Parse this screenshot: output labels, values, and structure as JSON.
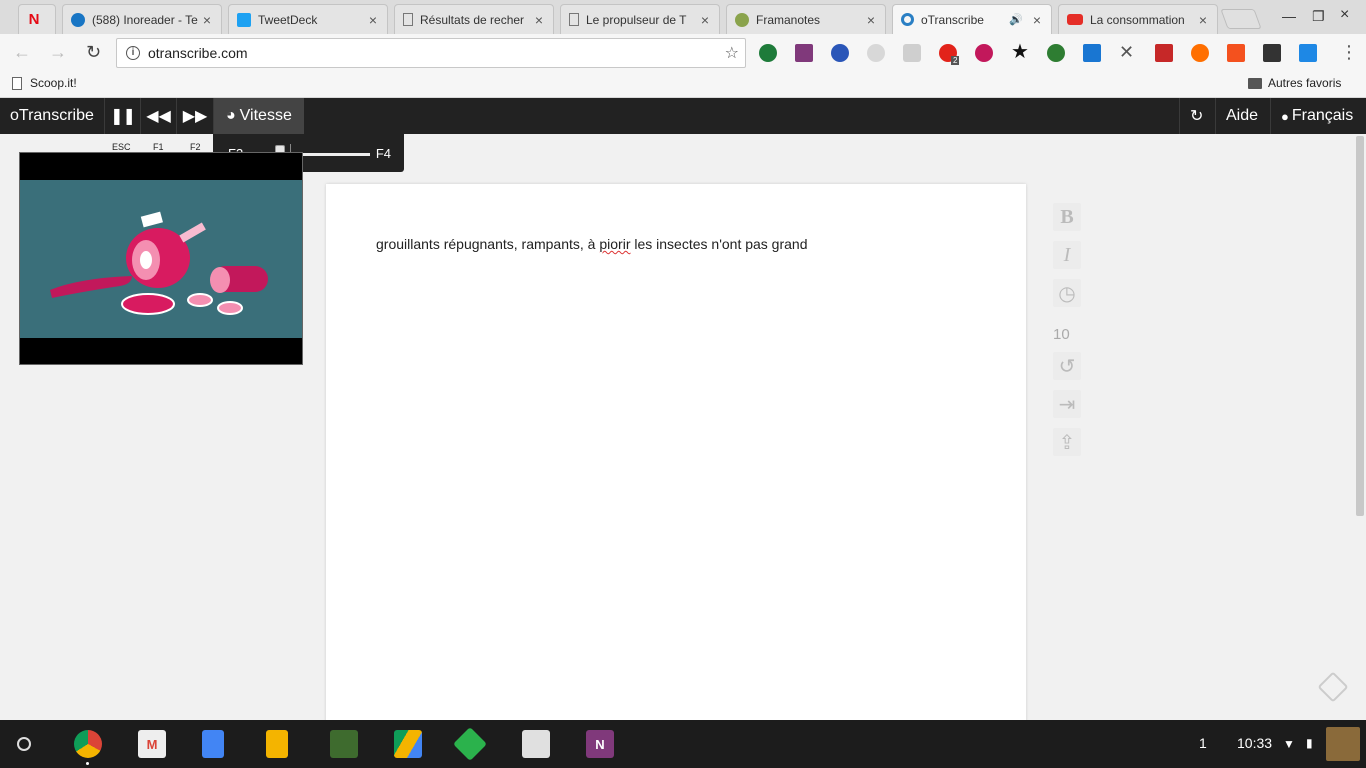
{
  "browser": {
    "tabs": [
      {
        "title": "",
        "favicon": "netflix-icon",
        "color": "#e50914",
        "glyph": "N"
      },
      {
        "title": "(588) Inoreader - Te",
        "favicon": "inoreader-icon",
        "color": "#1875c4",
        "glyph": ""
      },
      {
        "title": "TweetDeck",
        "favicon": "tweetdeck-icon",
        "color": "#1da1f2",
        "glyph": ""
      },
      {
        "title": "Résultats de recher",
        "favicon": "document-icon",
        "color": "",
        "glyph": ""
      },
      {
        "title": "Le propulseur de T",
        "favicon": "document-icon",
        "color": "",
        "glyph": ""
      },
      {
        "title": "Framanotes",
        "favicon": "framanotes-icon",
        "color": "#8aa34c",
        "glyph": ""
      },
      {
        "title": "oTranscribe",
        "favicon": "otranscribe-icon",
        "color": "#2a7fc4",
        "glyph": ""
      },
      {
        "title": "La consommation",
        "favicon": "youtube-icon",
        "color": "#e52d27",
        "glyph": ""
      }
    ],
    "url": "otranscribe.com",
    "bookmarks": {
      "scoopit": "Scoop.it!",
      "other": "Autres favoris"
    },
    "extension_badge": "2"
  },
  "app": {
    "brand": "oTranscribe",
    "speed_label": "Vitesse",
    "key_hints": [
      "ESC",
      "F1",
      "F2"
    ],
    "speed_popup": {
      "slower_key": "F3",
      "faster_key": "F4",
      "value": 0.25
    },
    "help_label": "Aide",
    "language_label": "Français",
    "transcript": {
      "before": "grouillants répugnants, rampants, à ",
      "misspelled": "piorir",
      "after": " les insectes n'ont pas grand"
    },
    "skip_seconds": "10"
  },
  "shelf": {
    "notification_count": "1",
    "time": "10:33"
  }
}
